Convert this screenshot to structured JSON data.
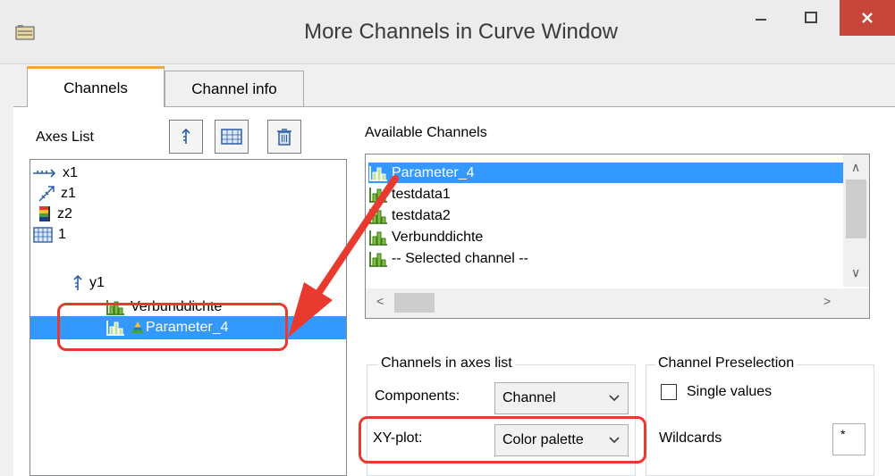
{
  "window": {
    "title": "More Channels in Curve Window",
    "minimize_glyph": "—",
    "maximize_glyph": "☐",
    "close_glyph": "✕"
  },
  "tabs": [
    {
      "label": "Channels",
      "active": true
    },
    {
      "label": "Channel info",
      "active": false
    }
  ],
  "axes_list": {
    "label": "Axes List",
    "toolbar_icons": [
      "y-axis-icon",
      "frame-grid-icon",
      "trash-icon"
    ],
    "tree": [
      {
        "label": "x1",
        "icon": "x-axis-icon",
        "level": 0
      },
      {
        "label": "z1",
        "icon": "z-axis-3d-icon",
        "level": 0
      },
      {
        "label": "z2",
        "icon": "color-bar-icon",
        "level": 0
      },
      {
        "label": "1",
        "icon": "frame-grid-icon",
        "level": 0
      },
      {
        "label": "y1",
        "icon": "y-axis-icon",
        "level": 1
      },
      {
        "label": "Verbunddichte",
        "icon": "channel-icon",
        "level": 2
      },
      {
        "label": "Parameter_4",
        "icon": "channel-icon",
        "level": 2,
        "selected": true,
        "secondary_icon": "color-palette-icon"
      }
    ]
  },
  "available_channels": {
    "label": "Available Channels",
    "items": [
      {
        "label": "Parameter_4",
        "selected": true
      },
      {
        "label": "testdata1"
      },
      {
        "label": "testdata2"
      },
      {
        "label": "Verbunddichte"
      },
      {
        "label": "-- Selected channel --"
      }
    ],
    "scroll_up_glyph": "∧",
    "scroll_down_glyph": "∨",
    "scroll_left_glyph": "<",
    "scroll_right_glyph": ">"
  },
  "channels_in_axes": {
    "title": "Channels in axes list",
    "components_label": "Components:",
    "components_value": "Channel",
    "xyplot_label": "XY-plot:",
    "xyplot_value": "Color palette"
  },
  "preselection": {
    "title": "Channel Preselection",
    "single_values_label": "Single values",
    "single_values_checked": false,
    "wildcards_label": "Wildcards",
    "wildcards_value": "*"
  },
  "colors": {
    "selection": "#3399ff",
    "callout": "#e83a2f",
    "close_button": "#c7463a",
    "tab_accent": "#f2a93b"
  }
}
